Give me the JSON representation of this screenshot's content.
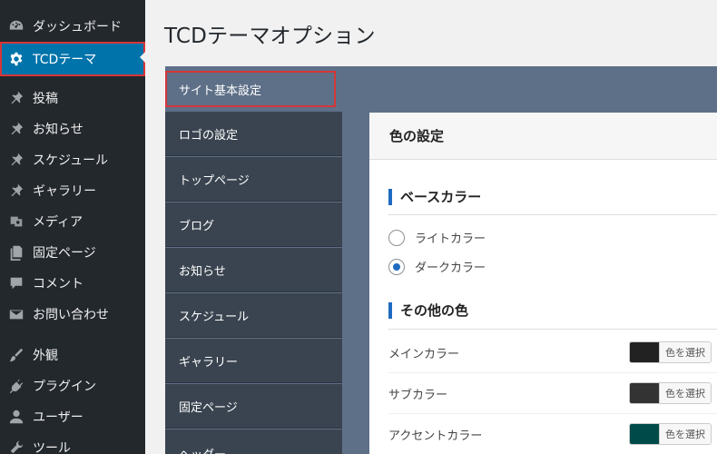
{
  "admin_menu": [
    {
      "label": "ダッシュボード",
      "icon": "dashboard-icon",
      "current": false
    },
    {
      "label": "TCDテーマ",
      "icon": "gear-icon",
      "current": true
    },
    {
      "label": "投稿",
      "icon": "pin-icon",
      "current": false
    },
    {
      "label": "お知らせ",
      "icon": "pin-icon",
      "current": false
    },
    {
      "label": "スケジュール",
      "icon": "pin-icon",
      "current": false
    },
    {
      "label": "ギャラリー",
      "icon": "pin-icon",
      "current": false
    },
    {
      "label": "メディア",
      "icon": "media-icon",
      "current": false
    },
    {
      "label": "固定ページ",
      "icon": "page-icon",
      "current": false
    },
    {
      "label": "コメント",
      "icon": "comment-icon",
      "current": false
    },
    {
      "label": "お問い合わせ",
      "icon": "mail-icon",
      "current": false
    },
    {
      "label": "外観",
      "icon": "brush-icon",
      "current": false
    },
    {
      "label": "プラグイン",
      "icon": "plugin-icon",
      "current": false
    },
    {
      "label": "ユーザー",
      "icon": "user-icon",
      "current": false
    },
    {
      "label": "ツール",
      "icon": "wrench-icon",
      "current": false
    }
  ],
  "page": {
    "title": "TCDテーマオプション"
  },
  "tabs": [
    {
      "label": "サイト基本設定",
      "active": true
    },
    {
      "label": "ロゴの設定",
      "active": false
    },
    {
      "label": "トップページ",
      "active": false
    },
    {
      "label": "ブログ",
      "active": false
    },
    {
      "label": "お知らせ",
      "active": false
    },
    {
      "label": "スケジュール",
      "active": false
    },
    {
      "label": "ギャラリー",
      "active": false
    },
    {
      "label": "固定ページ",
      "active": false
    },
    {
      "label": "ヘッダー",
      "active": false
    }
  ],
  "card": {
    "title": "色の設定",
    "base_color": {
      "heading": "ベースカラー",
      "options": [
        {
          "label": "ライトカラー",
          "checked": false
        },
        {
          "label": "ダークカラー",
          "checked": true
        }
      ]
    },
    "other_colors": {
      "heading": "その他の色",
      "rows": [
        {
          "label": "メインカラー",
          "color": "#222222",
          "button": "色を選択"
        },
        {
          "label": "サブカラー",
          "color": "#333333",
          "button": "色を選択"
        },
        {
          "label": "アクセントカラー",
          "color": "#004a4a",
          "button": "色を選択"
        }
      ]
    }
  }
}
